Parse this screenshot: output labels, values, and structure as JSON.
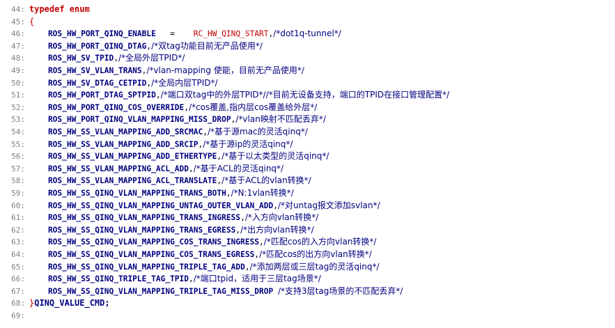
{
  "editor": {
    "lines": [
      {
        "num": "44:",
        "parts": [
          {
            "t": "typedef enum",
            "c": "kw"
          }
        ]
      },
      {
        "num": "45:",
        "parts": [
          {
            "t": "{",
            "c": "brace"
          }
        ]
      },
      {
        "num": "46:",
        "parts": [
          {
            "t": "    ROS_HW_PORT_QINQ_ENABLE  ",
            "c": "ident"
          },
          {
            "t": " =    ",
            "c": "op"
          },
          {
            "t": "RC_HW_QINQ_START",
            "c": "macro"
          },
          {
            "t": ",",
            "c": "op"
          },
          {
            "t": "/*dot1q-tunnel*/",
            "c": "cm"
          }
        ]
      },
      {
        "num": "47:",
        "parts": [
          {
            "t": "    ROS_HW_PORT_QINQ_DTAG",
            "c": "ident"
          },
          {
            "t": ",",
            "c": "op"
          },
          {
            "t": "/*双tag功能目前无产品使用*/",
            "c": "cm"
          }
        ]
      },
      {
        "num": "48:",
        "parts": [
          {
            "t": "    ROS_HW_SV_TPID",
            "c": "ident"
          },
          {
            "t": ",",
            "c": "op"
          },
          {
            "t": "/*全局外层TPID*/",
            "c": "cm"
          }
        ]
      },
      {
        "num": "49:",
        "parts": [
          {
            "t": "    ROS_HW_SV_VLAN_TRANS",
            "c": "ident"
          },
          {
            "t": ",",
            "c": "op"
          },
          {
            "t": "/*vlan-mapping 使能，目前无产品使用*/",
            "c": "cm"
          }
        ]
      },
      {
        "num": "50:",
        "parts": [
          {
            "t": "    ROS_HW_SV_DTAG_CETPID",
            "c": "ident"
          },
          {
            "t": ",",
            "c": "op"
          },
          {
            "t": "/*全局内层TPID*/",
            "c": "cm"
          }
        ]
      },
      {
        "num": "51:",
        "parts": [
          {
            "t": "    ROS_HW_PORT_DTAG_SPTPID",
            "c": "ident"
          },
          {
            "t": ",",
            "c": "op"
          },
          {
            "t": "/*端口双tag中的外层TPID*//*目前无设备支持，端口的TPID在接口管理配置*/",
            "c": "cm"
          }
        ]
      },
      {
        "num": "52:",
        "parts": [
          {
            "t": "    ROS_HW_PORT_QINQ_COS_OVERRIDE",
            "c": "ident"
          },
          {
            "t": ",",
            "c": "op"
          },
          {
            "t": "/*cos覆盖,指内层cos覆盖给外层*/",
            "c": "cm"
          }
        ]
      },
      {
        "num": "53:",
        "parts": [
          {
            "t": "    ROS_HW_PORT_QINQ_VLAN_MAPPING_MISS_DROP",
            "c": "ident"
          },
          {
            "t": ",",
            "c": "op"
          },
          {
            "t": "/*vlan映射不匹配丢弃*/",
            "c": "cm"
          }
        ]
      },
      {
        "num": "54:",
        "parts": [
          {
            "t": "    ROS_HW_SS_VLAN_MAPPING_ADD_SRCMAC",
            "c": "ident"
          },
          {
            "t": ",",
            "c": "op"
          },
          {
            "t": "/*基于源mac的灵活qinq*/",
            "c": "cm"
          }
        ]
      },
      {
        "num": "55:",
        "parts": [
          {
            "t": "    ROS_HW_SS_VLAN_MAPPING_ADD_SRCIP",
            "c": "ident"
          },
          {
            "t": ",",
            "c": "op"
          },
          {
            "t": "/*基于源ip的灵活qinq*/",
            "c": "cm"
          }
        ]
      },
      {
        "num": "56:",
        "parts": [
          {
            "t": "    ROS_HW_SS_VLAN_MAPPING_ADD_ETHERTYPE",
            "c": "ident"
          },
          {
            "t": ",",
            "c": "op"
          },
          {
            "t": "/*基于以太类型的灵活qinq*/",
            "c": "cm"
          }
        ]
      },
      {
        "num": "57:",
        "parts": [
          {
            "t": "    ROS_HW_SS_VLAN_MAPPING_ACL_ADD",
            "c": "ident"
          },
          {
            "t": ",",
            "c": "op"
          },
          {
            "t": "/*基于ACL的灵活qinq*/",
            "c": "cm"
          }
        ]
      },
      {
        "num": "58:",
        "parts": [
          {
            "t": "    ROS_HW_SS_VLAN_MAPPING_ACL_TRANSLATE",
            "c": "ident"
          },
          {
            "t": ",",
            "c": "op"
          },
          {
            "t": "/*基于ACL的vlan转换*/",
            "c": "cm"
          }
        ]
      },
      {
        "num": "59:",
        "parts": [
          {
            "t": "    ROS_HW_SS_QINQ_VLAN_MAPPING_TRANS_BOTH",
            "c": "ident"
          },
          {
            "t": ",",
            "c": "op"
          },
          {
            "t": "/*N:1vlan转换*/",
            "c": "cm"
          }
        ]
      },
      {
        "num": "60:",
        "parts": [
          {
            "t": "    ROS_HW_SS_QINQ_VLAN_MAPPING_UNTAG_OUTER_VLAN_ADD",
            "c": "ident"
          },
          {
            "t": ",",
            "c": "op"
          },
          {
            "t": "/*对untag报文添加svlan*/",
            "c": "cm"
          }
        ]
      },
      {
        "num": "61:",
        "parts": [
          {
            "t": "    ROS_HW_SS_QINQ_VLAN_MAPPING_TRANS_INGRESS",
            "c": "ident"
          },
          {
            "t": ",",
            "c": "op"
          },
          {
            "t": "/*入方向vlan转换*/",
            "c": "cm"
          }
        ]
      },
      {
        "num": "62:",
        "parts": [
          {
            "t": "    ROS_HW_SS_QINQ_VLAN_MAPPING_TRANS_EGRESS",
            "c": "ident"
          },
          {
            "t": ",",
            "c": "op"
          },
          {
            "t": "/*出方向vlan转换*/",
            "c": "cm"
          }
        ]
      },
      {
        "num": "63:",
        "parts": [
          {
            "t": "    ROS_HW_SS_QINQ_VLAN_MAPPING_COS_TRANS_INGRESS",
            "c": "ident"
          },
          {
            "t": ",",
            "c": "op"
          },
          {
            "t": "/*匹配cos的入方向vlan转换*/",
            "c": "cm"
          }
        ]
      },
      {
        "num": "64:",
        "parts": [
          {
            "t": "    ROS_HW_SS_QINQ_VLAN_MAPPING_COS_TRANS_EGRESS",
            "c": "ident"
          },
          {
            "t": ",",
            "c": "op"
          },
          {
            "t": "/*匹配cos的出方向vlan转换*/",
            "c": "cm"
          }
        ]
      },
      {
        "num": "65:",
        "parts": [
          {
            "t": "    ROS_HW_SS_QINQ_VLAN_MAPPING_TRIPLE_TAG_ADD",
            "c": "ident"
          },
          {
            "t": ",",
            "c": "op"
          },
          {
            "t": "/*添加两层或三层tag的灵活qinq*/",
            "c": "cm"
          }
        ]
      },
      {
        "num": "66:",
        "parts": [
          {
            "t": "    ROS_HW_SS_QINQ_TRIPLE_TAG_TPID",
            "c": "ident"
          },
          {
            "t": ",",
            "c": "op"
          },
          {
            "t": "/*端口tpid，适用于三层tag场景*/",
            "c": "cm"
          }
        ]
      },
      {
        "num": "67:",
        "parts": [
          {
            "t": "    ROS_HW_SS_QINQ_VLAN_MAPPING_TRIPLE_TAG_MISS_DROP",
            "c": "ident"
          },
          {
            "t": " ",
            "c": "op"
          },
          {
            "t": "/*支持3层tag场景的不匹配丢弃*/",
            "c": "cm"
          }
        ]
      },
      {
        "num": "68:",
        "parts": [
          {
            "t": "}",
            "c": "brace"
          },
          {
            "t": "QINQ_VALUE_CMD",
            "c": "cmd-name"
          },
          {
            "t": ";",
            "c": "cmd-name"
          }
        ]
      },
      {
        "num": "69:",
        "parts": []
      }
    ]
  }
}
